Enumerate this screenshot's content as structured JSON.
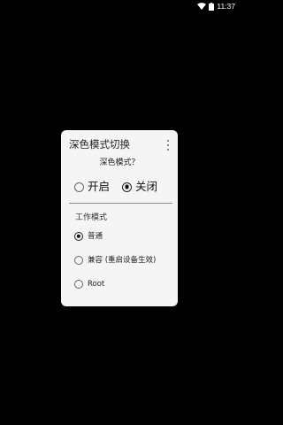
{
  "status_bar": {
    "time": "11:37",
    "wifi_icon": "wifi-icon",
    "battery_icon": "battery-icon"
  },
  "dialog": {
    "title": "深色模式切换",
    "menu_icon": "more-vert-icon",
    "question": "深色模式？",
    "options": [
      {
        "label": "开启",
        "checked": false
      },
      {
        "label": "关闭",
        "checked": true
      }
    ],
    "section_title": "工作模式",
    "modes": [
      {
        "label": "普通",
        "checked": true
      },
      {
        "label": "兼容 (重启设备生效)",
        "checked": false
      },
      {
        "label": "Root",
        "checked": false
      }
    ]
  }
}
